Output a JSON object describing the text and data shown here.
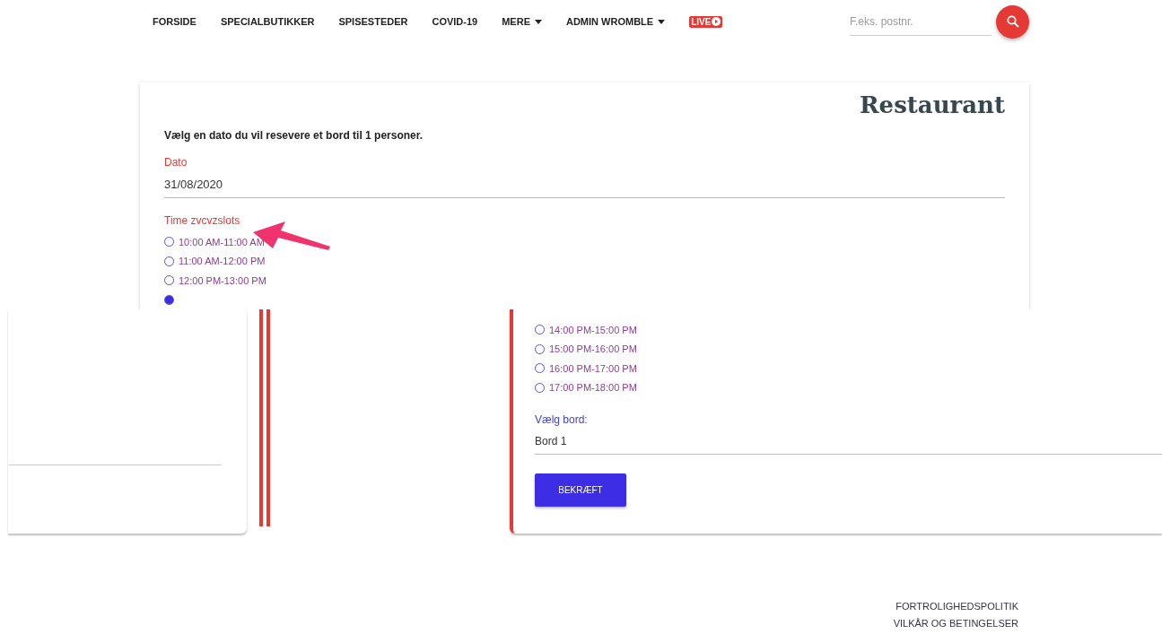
{
  "nav": {
    "items": [
      {
        "label": "FORSIDE",
        "dropdown": false
      },
      {
        "label": "SPECIALBUTIKKER",
        "dropdown": false
      },
      {
        "label": "SPISESTEDER",
        "dropdown": false
      },
      {
        "label": "COVID-19",
        "dropdown": false
      },
      {
        "label": "MERE",
        "dropdown": true
      },
      {
        "label": "ADMIN WROMBLE",
        "dropdown": true
      }
    ],
    "live_badge": "LIVE",
    "search": {
      "placeholder": "F.eks. postnr."
    }
  },
  "card": {
    "title": "Restaurant",
    "intro": "Vælg en dato du vil resevere et bord til 1 personer.",
    "date_label": "Dato",
    "date_value": "31/08/2020",
    "slots_label": "Time zvcvzslots",
    "time_slots": [
      {
        "label": "10:00 AM-11:00 AM",
        "selected": false
      },
      {
        "label": "11:00 AM-12:00 PM",
        "selected": false
      },
      {
        "label": "12:00 PM-13:00 PM",
        "selected": false
      },
      {
        "selected": true
      },
      {
        "label": "14:00 PM-15:00 PM",
        "selected": false
      },
      {
        "label": "15:00 PM-16:00 PM",
        "selected": false
      },
      {
        "label": "16:00 PM-17:00 PM",
        "selected": false
      },
      {
        "label": "17:00 PM-18:00 PM",
        "selected": false
      }
    ],
    "table_label": "Vælg bord:",
    "table_value": "Bord 1",
    "confirm_button": "BEKRÆFT"
  },
  "footer": {
    "links": [
      "FORTROLIGHEDSPOLITIK",
      "VILKÅR OG BETINGELSER"
    ]
  }
}
